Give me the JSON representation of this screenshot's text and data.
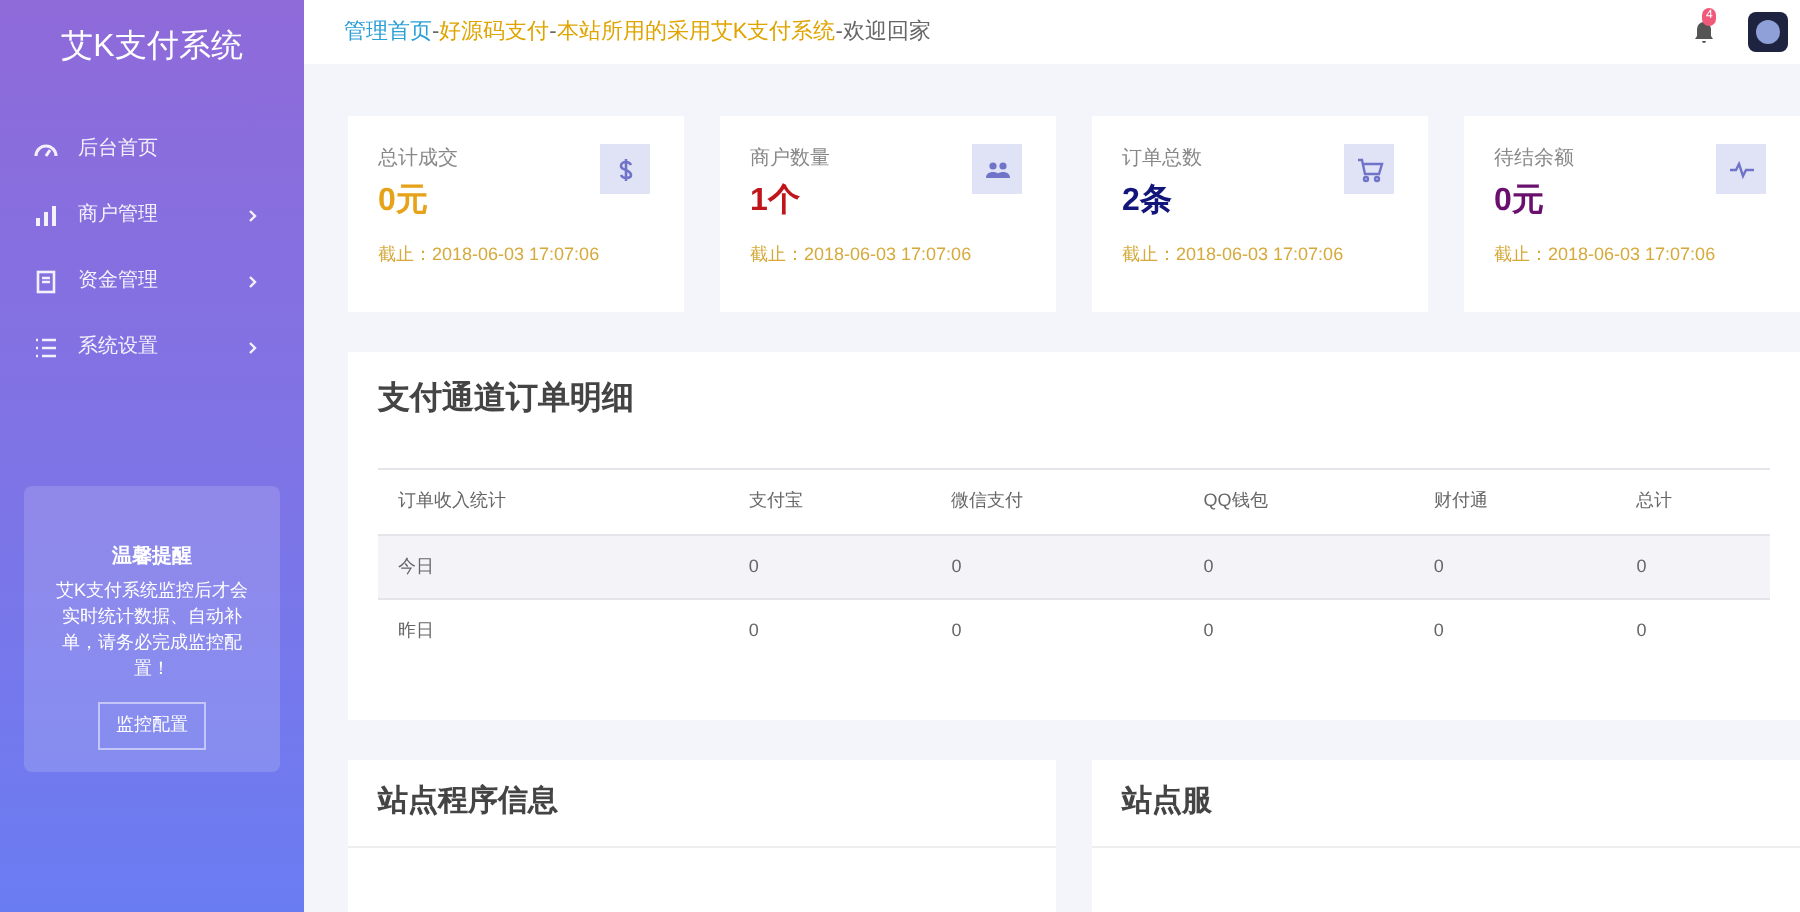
{
  "sidebar": {
    "title": "艾K支付系统",
    "items": [
      {
        "label": "后台首页",
        "has_submenu": false
      },
      {
        "label": "商户管理",
        "has_submenu": true
      },
      {
        "label": "资金管理",
        "has_submenu": true
      },
      {
        "label": "系统设置",
        "has_submenu": true
      }
    ],
    "notice": {
      "title": "温馨提醒",
      "text": "艾K支付系统监控后才会实时统计数据、自动补单，请务必完成监控配置！",
      "button": "监控配置"
    }
  },
  "header": {
    "breadcrumb": [
      {
        "text": "管理首页",
        "color": "#2a9fd6"
      },
      {
        "text": "-",
        "color": "#666666"
      },
      {
        "text": "好源码支付",
        "color": "#e0a400"
      },
      {
        "text": "-",
        "color": "#666666"
      },
      {
        "text": "本站所用的采用艾K支付系统",
        "color": "#e0a400"
      },
      {
        "text": "-欢迎回家",
        "color": "#666666"
      }
    ],
    "notification_count": "4"
  },
  "stats": [
    {
      "label": "总计成交",
      "value": "0元",
      "color": "#e6a219",
      "note": "截止：2018-06-03 17:07:06"
    },
    {
      "label": "商户数量",
      "value": "1个",
      "color": "#c0151b",
      "note": "截止：2018-06-03 17:07:06"
    },
    {
      "label": "订单总数",
      "value": "2条",
      "color": "#12167a",
      "note": "截止：2018-06-03 17:07:06"
    },
    {
      "label": "待结余额",
      "value": "0元",
      "color": "#6a0f6e",
      "note": "截止：2018-06-03 17:07:06"
    }
  ],
  "orders": {
    "title": "支付通道订单明细",
    "columns": [
      "订单收入统计",
      "支付宝",
      "微信支付",
      "QQ钱包",
      "财付通",
      "总计"
    ],
    "rows": [
      [
        "今日",
        "0",
        "0",
        "0",
        "0",
        "0"
      ],
      [
        "昨日",
        "0",
        "0",
        "0",
        "0",
        "0"
      ]
    ]
  },
  "panels": [
    {
      "title": "站点程序信息"
    },
    {
      "title": "站点服"
    }
  ]
}
